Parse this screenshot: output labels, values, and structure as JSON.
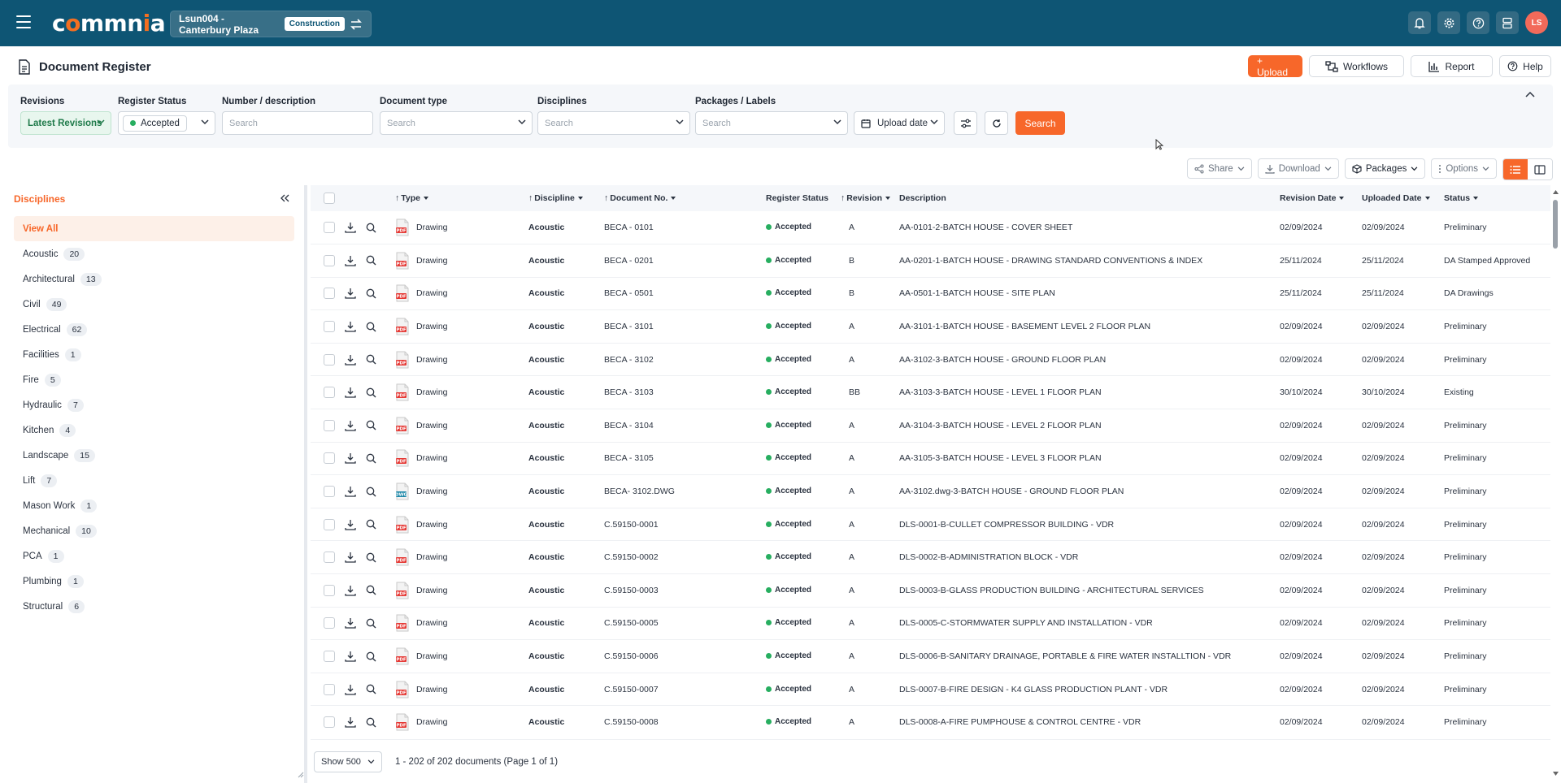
{
  "app": {
    "logo_text": "commnia"
  },
  "project": {
    "name": "Lsun004 - Canterbury Plaza",
    "tag": "Construction"
  },
  "user": {
    "initials": "LS"
  },
  "page": {
    "title": "Document Register"
  },
  "actions": {
    "upload": "+ Upload",
    "workflows": "Workflows",
    "report": "Report",
    "help": "Help"
  },
  "filters": {
    "revisions_label": "Revisions",
    "revisions_value": "Latest Revisions",
    "register_status_label": "Register Status",
    "register_status_value": "Accepted",
    "number_label": "Number / description",
    "number_placeholder": "Search",
    "doc_type_label": "Document type",
    "doc_type_placeholder": "Search",
    "disciplines_label": "Disciplines",
    "disciplines_placeholder": "Search",
    "packages_label": "Packages / Labels",
    "packages_placeholder": "Search",
    "upload_date": "Upload date",
    "search_button": "Search"
  },
  "toolbar": {
    "share": "Share",
    "download": "Download",
    "packages": "Packages",
    "options": "Options"
  },
  "sidebar": {
    "title": "Disciplines",
    "view_all": "View All",
    "items": [
      {
        "label": "Acoustic",
        "count": "20"
      },
      {
        "label": "Architectural",
        "count": "13"
      },
      {
        "label": "Civil",
        "count": "49"
      },
      {
        "label": "Electrical",
        "count": "62"
      },
      {
        "label": "Facilities",
        "count": "1"
      },
      {
        "label": "Fire",
        "count": "5"
      },
      {
        "label": "Hydraulic",
        "count": "7"
      },
      {
        "label": "Kitchen",
        "count": "4"
      },
      {
        "label": "Landscape",
        "count": "15"
      },
      {
        "label": "Lift",
        "count": "7"
      },
      {
        "label": "Mason Work",
        "count": "1"
      },
      {
        "label": "Mechanical",
        "count": "10"
      },
      {
        "label": "PCA",
        "count": "1"
      },
      {
        "label": "Plumbing",
        "count": "1"
      },
      {
        "label": "Structural",
        "count": "6"
      }
    ]
  },
  "table": {
    "columns": {
      "type": "Type",
      "discipline": "Discipline",
      "doc_no": "Document No.",
      "register_status": "Register Status",
      "revision": "Revision",
      "description": "Description",
      "revision_date": "Revision Date",
      "uploaded_date": "Uploaded Date",
      "status": "Status"
    },
    "rows": [
      {
        "file": "PDF",
        "type": "Drawing",
        "discipline": "Acoustic",
        "doc_no": "BECA - 0101",
        "reg": "Accepted",
        "rev": "A",
        "desc": "AA-0101-2-BATCH HOUSE - COVER SHEET",
        "rev_date": "02/09/2024",
        "up_date": "02/09/2024",
        "status": "Preliminary"
      },
      {
        "file": "PDF",
        "type": "Drawing",
        "discipline": "Acoustic",
        "doc_no": "BECA - 0201",
        "reg": "Accepted",
        "rev": "B",
        "desc": "AA-0201-1-BATCH HOUSE - DRAWING STANDARD CONVENTIONS & INDEX",
        "rev_date": "25/11/2024",
        "up_date": "25/11/2024",
        "status": "DA Stamped Approved"
      },
      {
        "file": "PDF",
        "type": "Drawing",
        "discipline": "Acoustic",
        "doc_no": "BECA - 0501",
        "reg": "Accepted",
        "rev": "B",
        "desc": "AA-0501-1-BATCH HOUSE - SITE PLAN",
        "rev_date": "25/11/2024",
        "up_date": "25/11/2024",
        "status": "DA Drawings"
      },
      {
        "file": "PDF",
        "type": "Drawing",
        "discipline": "Acoustic",
        "doc_no": "BECA - 3101",
        "reg": "Accepted",
        "rev": "A",
        "desc": "AA-3101-1-BATCH HOUSE - BASEMENT LEVEL 2 FLOOR PLAN",
        "rev_date": "02/09/2024",
        "up_date": "02/09/2024",
        "status": "Preliminary"
      },
      {
        "file": "PDF",
        "type": "Drawing",
        "discipline": "Acoustic",
        "doc_no": "BECA - 3102",
        "reg": "Accepted",
        "rev": "A",
        "desc": "AA-3102-3-BATCH HOUSE - GROUND FLOOR PLAN",
        "rev_date": "02/09/2024",
        "up_date": "02/09/2024",
        "status": "Preliminary"
      },
      {
        "file": "PDF",
        "type": "Drawing",
        "discipline": "Acoustic",
        "doc_no": "BECA - 3103",
        "reg": "Accepted",
        "rev": "BB",
        "desc": "AA-3103-3-BATCH HOUSE - LEVEL 1 FLOOR PLAN",
        "rev_date": "30/10/2024",
        "up_date": "30/10/2024",
        "status": "Existing"
      },
      {
        "file": "PDF",
        "type": "Drawing",
        "discipline": "Acoustic",
        "doc_no": "BECA - 3104",
        "reg": "Accepted",
        "rev": "A",
        "desc": "AA-3104-3-BATCH HOUSE - LEVEL 2 FLOOR PLAN",
        "rev_date": "02/09/2024",
        "up_date": "02/09/2024",
        "status": "Preliminary"
      },
      {
        "file": "PDF",
        "type": "Drawing",
        "discipline": "Acoustic",
        "doc_no": "BECA - 3105",
        "reg": "Accepted",
        "rev": "A",
        "desc": "AA-3105-3-BATCH HOUSE - LEVEL 3 FLOOR PLAN",
        "rev_date": "02/09/2024",
        "up_date": "02/09/2024",
        "status": "Preliminary"
      },
      {
        "file": "DWG",
        "type": "Drawing",
        "discipline": "Acoustic",
        "doc_no": "BECA- 3102.DWG",
        "reg": "Accepted",
        "rev": "A",
        "desc": "AA-3102.dwg-3-BATCH HOUSE - GROUND FLOOR PLAN",
        "rev_date": "02/09/2024",
        "up_date": "02/09/2024",
        "status": "Preliminary"
      },
      {
        "file": "PDF",
        "type": "Drawing",
        "discipline": "Acoustic",
        "doc_no": "C.59150-0001",
        "reg": "Accepted",
        "rev": "A",
        "desc": "DLS-0001-B-CULLET COMPRESSOR BUILDING - VDR",
        "rev_date": "02/09/2024",
        "up_date": "02/09/2024",
        "status": "Preliminary"
      },
      {
        "file": "PDF",
        "type": "Drawing",
        "discipline": "Acoustic",
        "doc_no": "C.59150-0002",
        "reg": "Accepted",
        "rev": "A",
        "desc": "DLS-0002-B-ADMINISTRATION BLOCK - VDR",
        "rev_date": "02/09/2024",
        "up_date": "02/09/2024",
        "status": "Preliminary"
      },
      {
        "file": "PDF",
        "type": "Drawing",
        "discipline": "Acoustic",
        "doc_no": "C.59150-0003",
        "reg": "Accepted",
        "rev": "A",
        "desc": "DLS-0003-B-GLASS PRODUCTION BUILDING - ARCHITECTURAL SERVICES",
        "rev_date": "02/09/2024",
        "up_date": "02/09/2024",
        "status": "Preliminary"
      },
      {
        "file": "PDF",
        "type": "Drawing",
        "discipline": "Acoustic",
        "doc_no": "C.59150-0005",
        "reg": "Accepted",
        "rev": "A",
        "desc": "DLS-0005-C-STORMWATER SUPPLY AND INSTALLATION - VDR",
        "rev_date": "02/09/2024",
        "up_date": "02/09/2024",
        "status": "Preliminary"
      },
      {
        "file": "PDF",
        "type": "Drawing",
        "discipline": "Acoustic",
        "doc_no": "C.59150-0006",
        "reg": "Accepted",
        "rev": "A",
        "desc": "DLS-0006-B-SANITARY DRAINAGE, PORTABLE & FIRE WATER INSTALLTION - VDR",
        "rev_date": "02/09/2024",
        "up_date": "02/09/2024",
        "status": "Preliminary"
      },
      {
        "file": "PDF",
        "type": "Drawing",
        "discipline": "Acoustic",
        "doc_no": "C.59150-0007",
        "reg": "Accepted",
        "rev": "A",
        "desc": "DLS-0007-B-FIRE DESIGN - K4 GLASS PRODUCTION PLANT - VDR",
        "rev_date": "02/09/2024",
        "up_date": "02/09/2024",
        "status": "Preliminary"
      },
      {
        "file": "PDF",
        "type": "Drawing",
        "discipline": "Acoustic",
        "doc_no": "C.59150-0008",
        "reg": "Accepted",
        "rev": "A",
        "desc": "DLS-0008-A-FIRE PUMPHOUSE & CONTROL CENTRE - VDR",
        "rev_date": "02/09/2024",
        "up_date": "02/09/2024",
        "status": "Preliminary"
      }
    ]
  },
  "footer": {
    "show": "Show 500",
    "page_info": "1 - 202 of 202 documents (Page 1 of 1)"
  },
  "colors": {
    "topbar": "#0e5574",
    "accent": "#f7672a",
    "accepted": "#27ae60",
    "pdf": "#e53935",
    "dwg": "#1e88a8"
  }
}
